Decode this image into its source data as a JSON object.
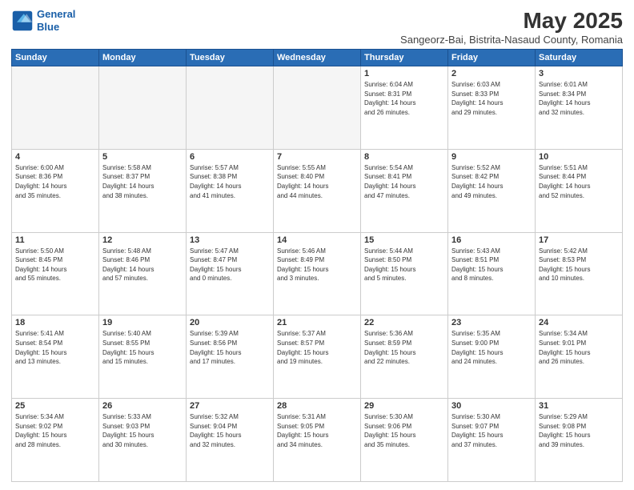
{
  "header": {
    "logo_line1": "General",
    "logo_line2": "Blue",
    "month_title": "May 2025",
    "subtitle": "Sangeorz-Bai, Bistrita-Nasaud County, Romania"
  },
  "weekdays": [
    "Sunday",
    "Monday",
    "Tuesday",
    "Wednesday",
    "Thursday",
    "Friday",
    "Saturday"
  ],
  "weeks": [
    [
      {
        "day": "",
        "info": ""
      },
      {
        "day": "",
        "info": ""
      },
      {
        "day": "",
        "info": ""
      },
      {
        "day": "",
        "info": ""
      },
      {
        "day": "1",
        "info": "Sunrise: 6:04 AM\nSunset: 8:31 PM\nDaylight: 14 hours\nand 26 minutes."
      },
      {
        "day": "2",
        "info": "Sunrise: 6:03 AM\nSunset: 8:33 PM\nDaylight: 14 hours\nand 29 minutes."
      },
      {
        "day": "3",
        "info": "Sunrise: 6:01 AM\nSunset: 8:34 PM\nDaylight: 14 hours\nand 32 minutes."
      }
    ],
    [
      {
        "day": "4",
        "info": "Sunrise: 6:00 AM\nSunset: 8:36 PM\nDaylight: 14 hours\nand 35 minutes."
      },
      {
        "day": "5",
        "info": "Sunrise: 5:58 AM\nSunset: 8:37 PM\nDaylight: 14 hours\nand 38 minutes."
      },
      {
        "day": "6",
        "info": "Sunrise: 5:57 AM\nSunset: 8:38 PM\nDaylight: 14 hours\nand 41 minutes."
      },
      {
        "day": "7",
        "info": "Sunrise: 5:55 AM\nSunset: 8:40 PM\nDaylight: 14 hours\nand 44 minutes."
      },
      {
        "day": "8",
        "info": "Sunrise: 5:54 AM\nSunset: 8:41 PM\nDaylight: 14 hours\nand 47 minutes."
      },
      {
        "day": "9",
        "info": "Sunrise: 5:52 AM\nSunset: 8:42 PM\nDaylight: 14 hours\nand 49 minutes."
      },
      {
        "day": "10",
        "info": "Sunrise: 5:51 AM\nSunset: 8:44 PM\nDaylight: 14 hours\nand 52 minutes."
      }
    ],
    [
      {
        "day": "11",
        "info": "Sunrise: 5:50 AM\nSunset: 8:45 PM\nDaylight: 14 hours\nand 55 minutes."
      },
      {
        "day": "12",
        "info": "Sunrise: 5:48 AM\nSunset: 8:46 PM\nDaylight: 14 hours\nand 57 minutes."
      },
      {
        "day": "13",
        "info": "Sunrise: 5:47 AM\nSunset: 8:47 PM\nDaylight: 15 hours\nand 0 minutes."
      },
      {
        "day": "14",
        "info": "Sunrise: 5:46 AM\nSunset: 8:49 PM\nDaylight: 15 hours\nand 3 minutes."
      },
      {
        "day": "15",
        "info": "Sunrise: 5:44 AM\nSunset: 8:50 PM\nDaylight: 15 hours\nand 5 minutes."
      },
      {
        "day": "16",
        "info": "Sunrise: 5:43 AM\nSunset: 8:51 PM\nDaylight: 15 hours\nand 8 minutes."
      },
      {
        "day": "17",
        "info": "Sunrise: 5:42 AM\nSunset: 8:53 PM\nDaylight: 15 hours\nand 10 minutes."
      }
    ],
    [
      {
        "day": "18",
        "info": "Sunrise: 5:41 AM\nSunset: 8:54 PM\nDaylight: 15 hours\nand 13 minutes."
      },
      {
        "day": "19",
        "info": "Sunrise: 5:40 AM\nSunset: 8:55 PM\nDaylight: 15 hours\nand 15 minutes."
      },
      {
        "day": "20",
        "info": "Sunrise: 5:39 AM\nSunset: 8:56 PM\nDaylight: 15 hours\nand 17 minutes."
      },
      {
        "day": "21",
        "info": "Sunrise: 5:37 AM\nSunset: 8:57 PM\nDaylight: 15 hours\nand 19 minutes."
      },
      {
        "day": "22",
        "info": "Sunrise: 5:36 AM\nSunset: 8:59 PM\nDaylight: 15 hours\nand 22 minutes."
      },
      {
        "day": "23",
        "info": "Sunrise: 5:35 AM\nSunset: 9:00 PM\nDaylight: 15 hours\nand 24 minutes."
      },
      {
        "day": "24",
        "info": "Sunrise: 5:34 AM\nSunset: 9:01 PM\nDaylight: 15 hours\nand 26 minutes."
      }
    ],
    [
      {
        "day": "25",
        "info": "Sunrise: 5:34 AM\nSunset: 9:02 PM\nDaylight: 15 hours\nand 28 minutes."
      },
      {
        "day": "26",
        "info": "Sunrise: 5:33 AM\nSunset: 9:03 PM\nDaylight: 15 hours\nand 30 minutes."
      },
      {
        "day": "27",
        "info": "Sunrise: 5:32 AM\nSunset: 9:04 PM\nDaylight: 15 hours\nand 32 minutes."
      },
      {
        "day": "28",
        "info": "Sunrise: 5:31 AM\nSunset: 9:05 PM\nDaylight: 15 hours\nand 34 minutes."
      },
      {
        "day": "29",
        "info": "Sunrise: 5:30 AM\nSunset: 9:06 PM\nDaylight: 15 hours\nand 35 minutes."
      },
      {
        "day": "30",
        "info": "Sunrise: 5:30 AM\nSunset: 9:07 PM\nDaylight: 15 hours\nand 37 minutes."
      },
      {
        "day": "31",
        "info": "Sunrise: 5:29 AM\nSunset: 9:08 PM\nDaylight: 15 hours\nand 39 minutes."
      }
    ]
  ]
}
